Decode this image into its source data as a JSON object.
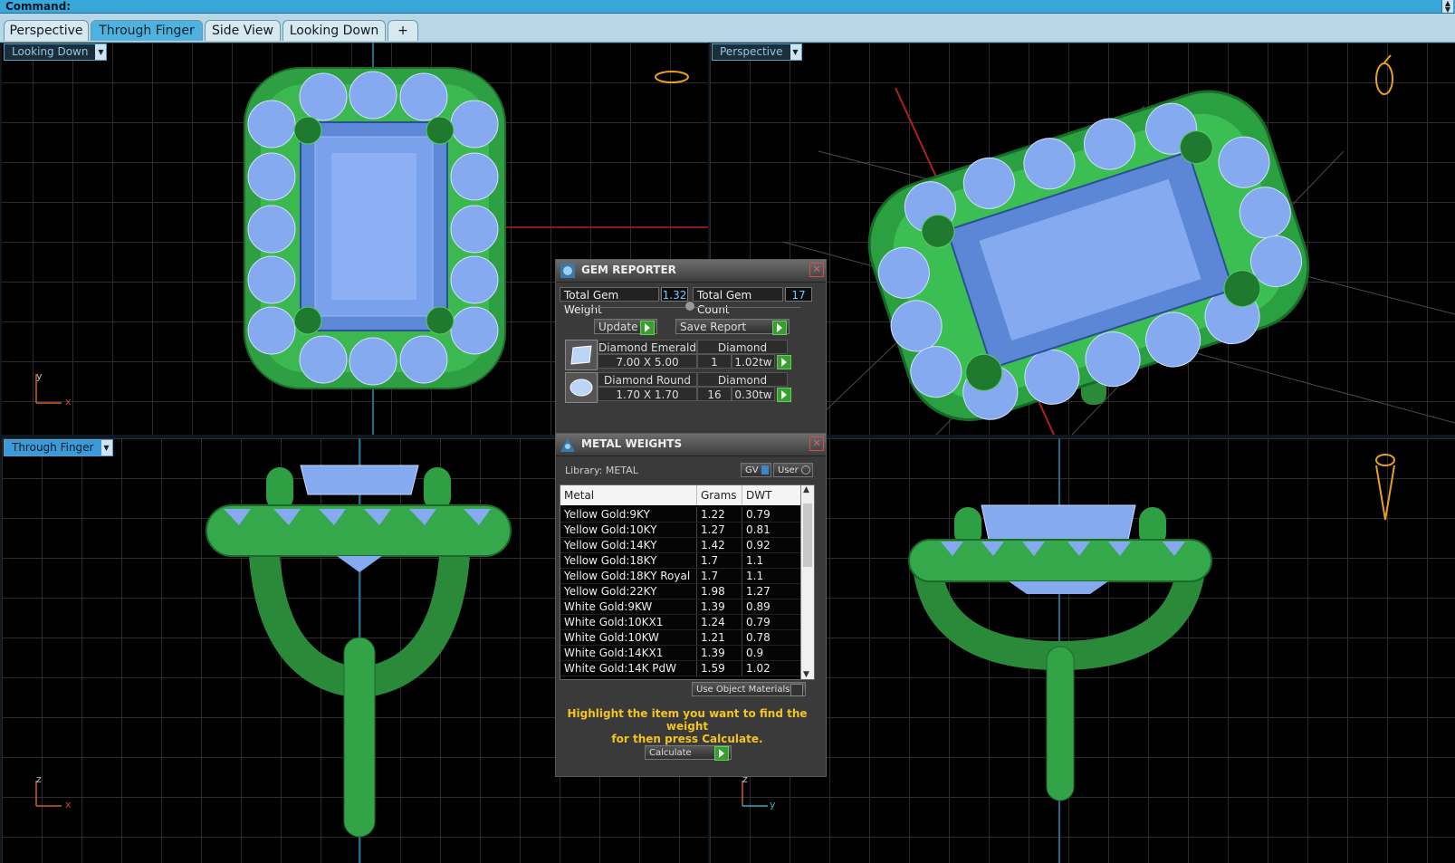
{
  "command_bar": {
    "label": "Command:"
  },
  "tabs": [
    {
      "label": "Perspective"
    },
    {
      "label": "Through Finger"
    },
    {
      "label": "Side View"
    },
    {
      "label": "Looking Down"
    },
    {
      "label": "+"
    }
  ],
  "viewports": {
    "top_left": {
      "label": "Looking Down",
      "axis_v": "y",
      "axis_h": "x"
    },
    "top_right": {
      "label": "Perspective"
    },
    "bottom_left": {
      "label": "Through Finger",
      "axis_v": "z",
      "axis_h": "x"
    },
    "bottom_right": {
      "label": "",
      "axis_v": "z",
      "axis_h": "y"
    }
  },
  "gem_reporter": {
    "title": "GEM REPORTER",
    "total_weight_label": "Total Gem Weight",
    "total_weight_value": "1.32",
    "total_count_label": "Total Gem Count",
    "total_count_value": "17",
    "update_label": "Update",
    "save_label": "Save Report",
    "gems": [
      {
        "name": "Diamond Emerald",
        "type": "Diamond",
        "size": "7.00 X 5.00",
        "count": "1",
        "weight": "1.02tw"
      },
      {
        "name": "Diamond Round",
        "type": "Diamond",
        "size": "1.70 X 1.70",
        "count": "16",
        "weight": "0.30tw"
      }
    ]
  },
  "metal_weights": {
    "title": "METAL WEIGHTS",
    "library_label": "Library: METAL",
    "gv_label": "GV",
    "user_label": "User",
    "columns": [
      "Metal",
      "Grams",
      "DWT"
    ],
    "rows": [
      {
        "metal": "Yellow Gold:9KY",
        "grams": "1.22",
        "dwt": "0.79"
      },
      {
        "metal": "Yellow Gold:10KY",
        "grams": "1.27",
        "dwt": "0.81"
      },
      {
        "metal": "Yellow Gold:14KY",
        "grams": "1.42",
        "dwt": "0.92"
      },
      {
        "metal": "Yellow Gold:18KY",
        "grams": "1.7",
        "dwt": "1.1"
      },
      {
        "metal": "Yellow Gold:18KY Royal",
        "grams": "1.7",
        "dwt": "1.1"
      },
      {
        "metal": "Yellow Gold:22KY",
        "grams": "1.98",
        "dwt": "1.27"
      },
      {
        "metal": "White Gold:9KW",
        "grams": "1.39",
        "dwt": "0.89"
      },
      {
        "metal": "White Gold:10KX1",
        "grams": "1.24",
        "dwt": "0.79"
      },
      {
        "metal": "White Gold:10KW",
        "grams": "1.21",
        "dwt": "0.78"
      },
      {
        "metal": "White Gold:14KX1",
        "grams": "1.39",
        "dwt": "0.9"
      },
      {
        "metal": "White Gold:14K PdW",
        "grams": "1.59",
        "dwt": "1.02"
      }
    ],
    "use_object_label": "Use Object Materials",
    "hint_line1": "Highlight the item you want to find the weight",
    "hint_line2": "for then press Calculate.",
    "calculate_label": "Calculate"
  },
  "colors": {
    "metal_green": "#2e9a3e",
    "gem_blue": "#7fa6e6",
    "accent_blue": "#4fb2de",
    "hint_yellow": "#f3c420"
  }
}
